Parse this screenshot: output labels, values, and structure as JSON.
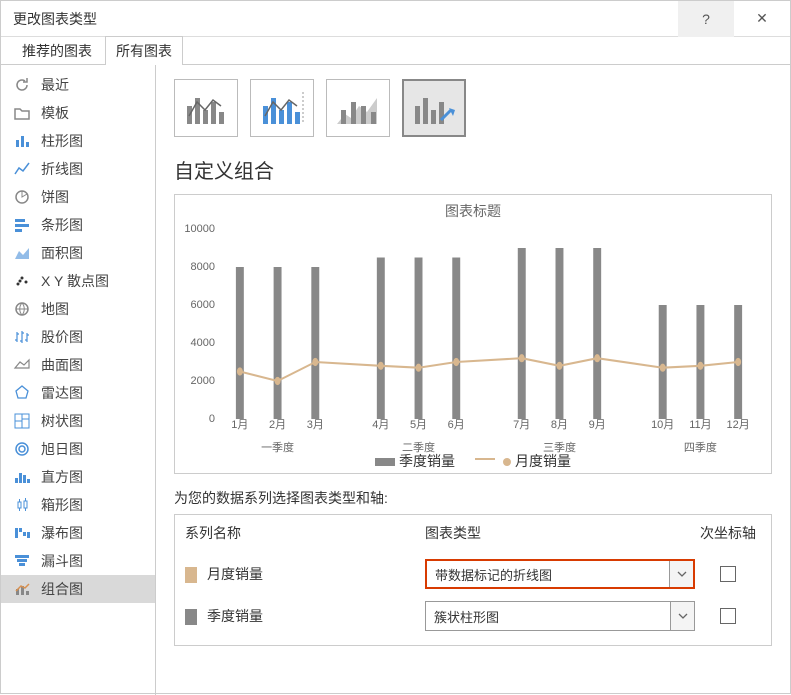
{
  "window": {
    "title": "更改图表类型",
    "help": "?",
    "close": "✕"
  },
  "tabs": {
    "recommended": "推荐的图表",
    "all": "所有图表"
  },
  "sidebar": {
    "items": [
      {
        "label": "最近"
      },
      {
        "label": "模板"
      },
      {
        "label": "柱形图"
      },
      {
        "label": "折线图"
      },
      {
        "label": "饼图"
      },
      {
        "label": "条形图"
      },
      {
        "label": "面积图"
      },
      {
        "label": "X Y 散点图"
      },
      {
        "label": "地图"
      },
      {
        "label": "股价图"
      },
      {
        "label": "曲面图"
      },
      {
        "label": "雷达图"
      },
      {
        "label": "树状图"
      },
      {
        "label": "旭日图"
      },
      {
        "label": "直方图"
      },
      {
        "label": "箱形图"
      },
      {
        "label": "瀑布图"
      },
      {
        "label": "漏斗图"
      },
      {
        "label": "组合图"
      }
    ]
  },
  "section_title": "自定义组合",
  "chart_preview": {
    "title": "图表标题"
  },
  "chart_data": {
    "type": "combo",
    "title": "图表标题",
    "ylabel": "",
    "xlabel": "",
    "ylim": [
      0,
      10000
    ],
    "yticks": [
      0,
      2000,
      4000,
      6000,
      8000,
      10000
    ],
    "groups": [
      {
        "label": "一季度",
        "categories": [
          "1月",
          "2月",
          "3月"
        ]
      },
      {
        "label": "二季度",
        "categories": [
          "4月",
          "5月",
          "6月"
        ]
      },
      {
        "label": "三季度",
        "categories": [
          "7月",
          "8月",
          "9月"
        ]
      },
      {
        "label": "四季度",
        "categories": [
          "10月",
          "11月",
          "12月"
        ]
      }
    ],
    "series": [
      {
        "name": "季度销量",
        "type": "bar",
        "values": [
          8000,
          8000,
          8000,
          8500,
          8500,
          8500,
          9000,
          9000,
          9000,
          6000,
          6000,
          6000
        ]
      },
      {
        "name": "月度销量",
        "type": "line_marker",
        "values": [
          2500,
          2000,
          3000,
          2800,
          2700,
          3000,
          3200,
          2800,
          3200,
          2700,
          2800,
          3000
        ]
      }
    ],
    "legend": [
      "季度销量",
      "月度销量"
    ]
  },
  "series_section": {
    "prompt": "为您的数据系列选择图表类型和轴:",
    "header": {
      "name": "系列名称",
      "type": "图表类型",
      "axis": "次坐标轴"
    },
    "rows": [
      {
        "name": "月度销量",
        "type": "带数据标记的折线图",
        "swatch": "#d8b78f",
        "highlight": true
      },
      {
        "name": "季度销量",
        "type": "簇状柱形图",
        "swatch": "#888888",
        "highlight": false
      }
    ]
  }
}
